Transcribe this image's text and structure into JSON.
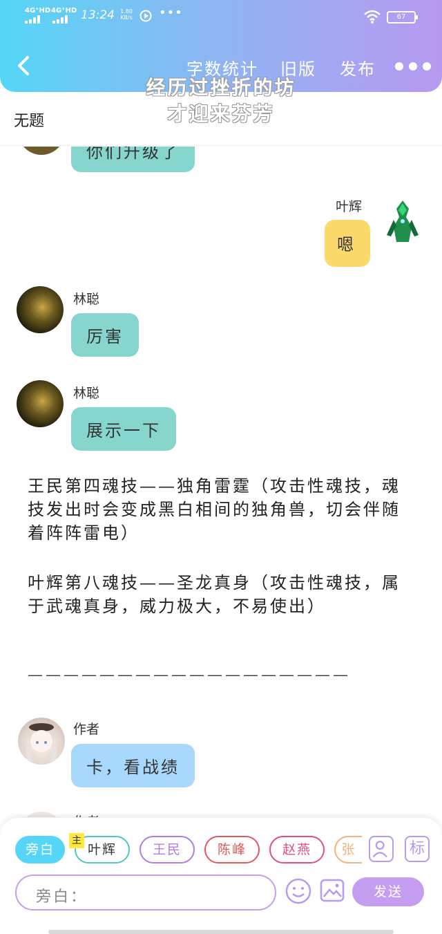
{
  "status_bar": {
    "signal1": "4G⁺HD",
    "signal2": "4G⁺HD",
    "time": "13:24",
    "net_speed": "1.80 KB/s",
    "overflow": "•••",
    "battery": "67"
  },
  "header": {
    "stats_label": "字数统计",
    "old_version_label": "旧版",
    "publish_label": "发布"
  },
  "document": {
    "title": "无题",
    "watermark_line1": "经历过挫折的坊",
    "watermark_line2": "才迎来芬芳"
  },
  "messages": [
    {
      "speaker": "",
      "text": "你们升级了",
      "color": "teal"
    },
    {
      "speaker": "叶辉",
      "text": "嗯",
      "color": "yellow"
    },
    {
      "speaker": "林聪",
      "text": "厉害",
      "color": "teal"
    },
    {
      "speaker": "林聪",
      "text": "展示一下",
      "color": "teal"
    },
    {
      "speaker": "作者",
      "text": "卡，看战绩",
      "color": "blue"
    },
    {
      "speaker": "作者",
      "text": "",
      "color": "blue"
    }
  ],
  "narration": [
    "王民第四魂技——独角雷霆（攻击性魂技，魂技发出时会变成黑白相间的独角兽，切会伴随着阵阵雷电）",
    "叶辉第八魂技——圣龙真身（攻击性魂技，属于武魂真身，威力极大，不易使出）"
  ],
  "divider": "——————————————————",
  "roles": [
    {
      "label": "旁白",
      "color": "#55d6f6"
    },
    {
      "label": "叶辉",
      "color": "#4fc7c0",
      "tag": "主"
    },
    {
      "label": "王民",
      "color": "#b37de0"
    },
    {
      "label": "陈峰",
      "color": "#e0595c"
    },
    {
      "label": "赵燕",
      "color": "#e24e7e"
    },
    {
      "label": "张",
      "color": "#f5b27c"
    }
  ],
  "toolbar": {
    "mark_label": "标",
    "input_placeholder": "旁白：",
    "send_label": "发送"
  },
  "colors": {
    "header_start": "#55d6f6",
    "header_end": "#b79af0",
    "teal_bubble": "#86d6cd",
    "yellow_bubble": "#fcd96b",
    "blue_bubble": "#a8d8fb",
    "send_button": "#c59ef2"
  }
}
